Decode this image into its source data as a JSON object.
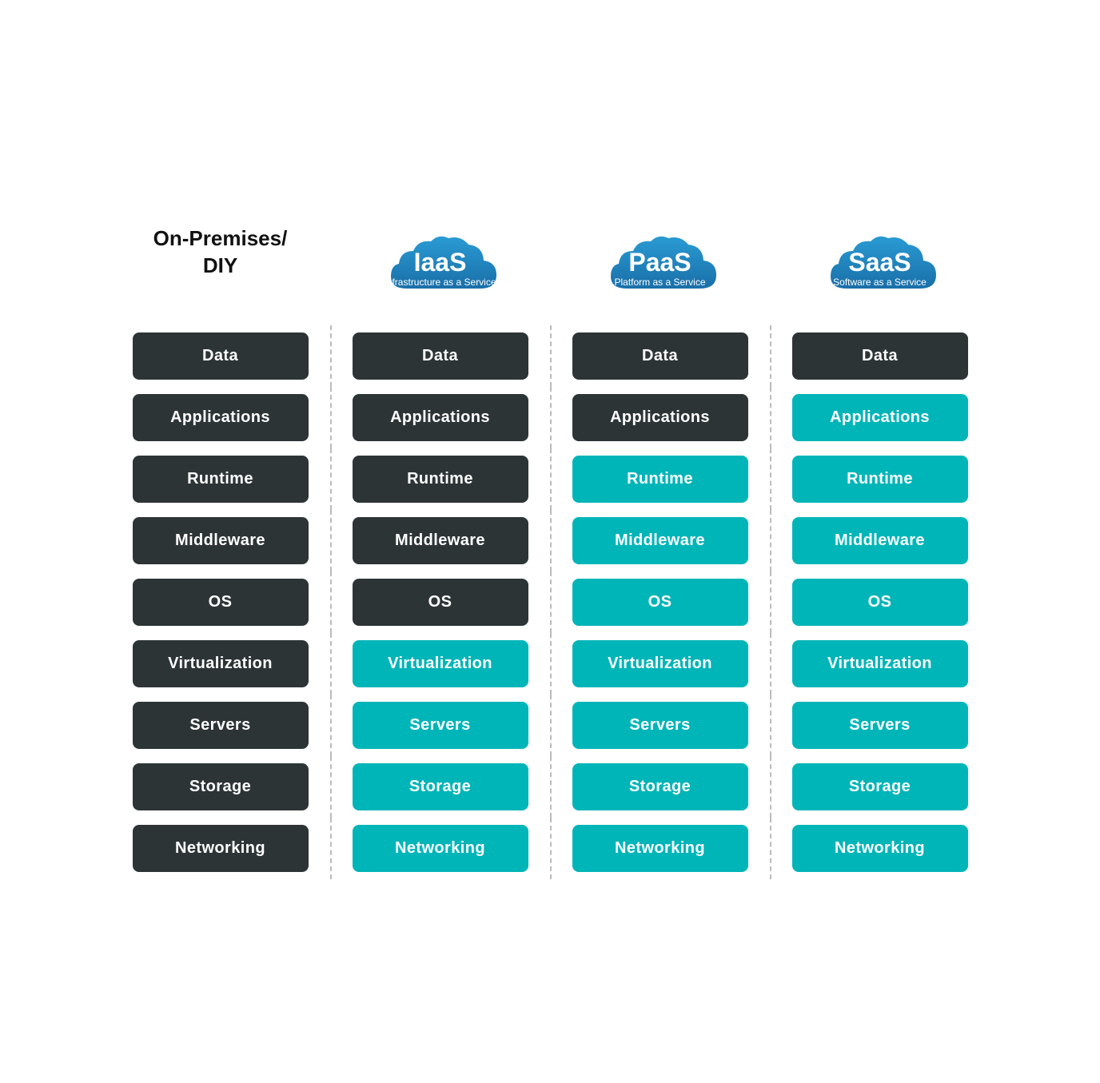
{
  "columns": [
    {
      "id": "on-premises",
      "headerType": "text",
      "headerTitle": "On-Premises/\nDIY"
    },
    {
      "id": "iaas",
      "headerType": "cloud",
      "cloudTitle": "IaaS",
      "cloudSubtitle": "Infrastructure as a Service",
      "cloudColor1": "#1a6fa8",
      "cloudColor2": "#2288cc"
    },
    {
      "id": "paas",
      "headerType": "cloud",
      "cloudTitle": "PaaS",
      "cloudSubtitle": "Platform as a Service",
      "cloudColor1": "#1a6fa8",
      "cloudColor2": "#2288cc"
    },
    {
      "id": "saas",
      "headerType": "cloud",
      "cloudTitle": "SaaS",
      "cloudSubtitle": "Software as a Service",
      "cloudColor1": "#1a6fa8",
      "cloudColor2": "#2288cc"
    }
  ],
  "rows": [
    {
      "label": "Data",
      "cells": [
        {
          "text": "Data",
          "style": "dark"
        },
        {
          "text": "Data",
          "style": "dark"
        },
        {
          "text": "Data",
          "style": "dark"
        },
        {
          "text": "Data",
          "style": "dark"
        }
      ]
    },
    {
      "label": "Applications",
      "cells": [
        {
          "text": "Applications",
          "style": "dark"
        },
        {
          "text": "Applications",
          "style": "dark"
        },
        {
          "text": "Applications",
          "style": "dark"
        },
        {
          "text": "Applications",
          "style": "teal"
        }
      ]
    },
    {
      "label": "Runtime",
      "cells": [
        {
          "text": "Runtime",
          "style": "dark"
        },
        {
          "text": "Runtime",
          "style": "dark"
        },
        {
          "text": "Runtime",
          "style": "teal"
        },
        {
          "text": "Runtime",
          "style": "teal"
        }
      ]
    },
    {
      "label": "Middleware",
      "cells": [
        {
          "text": "Middleware",
          "style": "dark"
        },
        {
          "text": "Middleware",
          "style": "dark"
        },
        {
          "text": "Middleware",
          "style": "teal"
        },
        {
          "text": "Middleware",
          "style": "teal"
        }
      ]
    },
    {
      "label": "OS",
      "cells": [
        {
          "text": "OS",
          "style": "dark"
        },
        {
          "text": "OS",
          "style": "dark"
        },
        {
          "text": "OS",
          "style": "teal"
        },
        {
          "text": "OS",
          "style": "teal"
        }
      ]
    },
    {
      "label": "Virtualization",
      "cells": [
        {
          "text": "Virtualization",
          "style": "dark"
        },
        {
          "text": "Virtualization",
          "style": "teal"
        },
        {
          "text": "Virtualization",
          "style": "teal"
        },
        {
          "text": "Virtualization",
          "style": "teal"
        }
      ]
    },
    {
      "label": "Servers",
      "cells": [
        {
          "text": "Servers",
          "style": "dark"
        },
        {
          "text": "Servers",
          "style": "teal"
        },
        {
          "text": "Servers",
          "style": "teal"
        },
        {
          "text": "Servers",
          "style": "teal"
        }
      ]
    },
    {
      "label": "Storage",
      "cells": [
        {
          "text": "Storage",
          "style": "dark"
        },
        {
          "text": "Storage",
          "style": "teal"
        },
        {
          "text": "Storage",
          "style": "teal"
        },
        {
          "text": "Storage",
          "style": "teal"
        }
      ]
    },
    {
      "label": "Networking",
      "cells": [
        {
          "text": "Networking",
          "style": "dark"
        },
        {
          "text": "Networking",
          "style": "teal"
        },
        {
          "text": "Networking",
          "style": "teal"
        },
        {
          "text": "Networking",
          "style": "teal"
        }
      ]
    }
  ]
}
